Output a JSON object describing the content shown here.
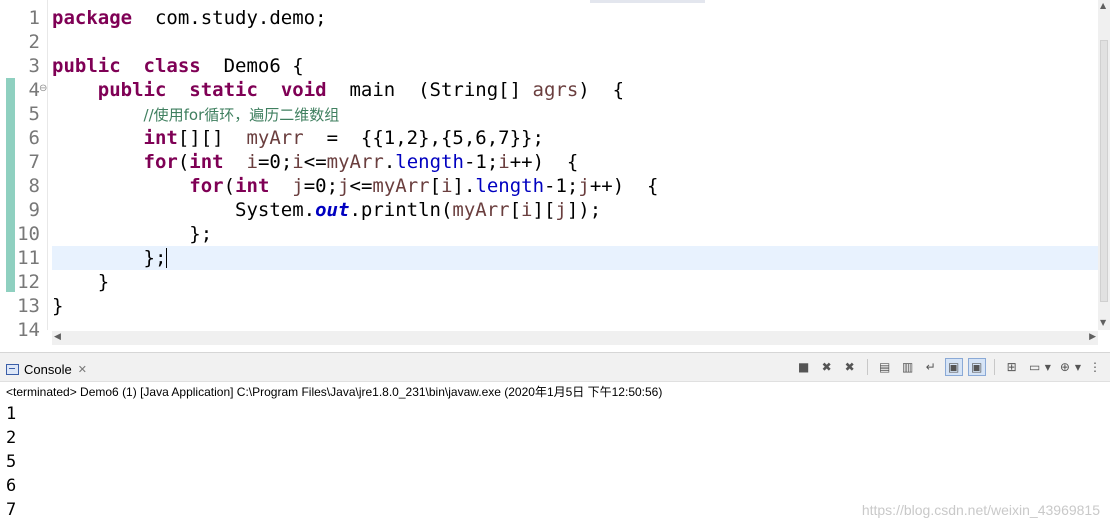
{
  "editor": {
    "lines": [
      {
        "num": "1",
        "segs": [
          [
            "kw",
            "package"
          ],
          [
            "",
            "  com.study.demo;"
          ]
        ]
      },
      {
        "num": "2",
        "segs": []
      },
      {
        "num": "3",
        "segs": [
          [
            "kw",
            "public"
          ],
          [
            "",
            "  "
          ],
          [
            "kw",
            "class"
          ],
          [
            "",
            "  Demo6 {"
          ]
        ]
      },
      {
        "num": "4",
        "fold": "⊖",
        "segs": [
          [
            "",
            "    "
          ],
          [
            "kw",
            "public"
          ],
          [
            "",
            "  "
          ],
          [
            "kw",
            "static"
          ],
          [
            "",
            "  "
          ],
          [
            "kw",
            "void"
          ],
          [
            "",
            "  main  (String[] "
          ],
          [
            "var",
            "agrs"
          ],
          [
            "",
            ")  {"
          ]
        ]
      },
      {
        "num": "5",
        "segs": [
          [
            "",
            "        "
          ],
          [
            "cm",
            "//使用for循环，遍历二维数组"
          ]
        ]
      },
      {
        "num": "6",
        "segs": [
          [
            "",
            "        "
          ],
          [
            "kw",
            "int"
          ],
          [
            "",
            "[][]  "
          ],
          [
            "var",
            "myArr"
          ],
          [
            "",
            "  =  {{1,2},{5,6,7}};"
          ]
        ]
      },
      {
        "num": "7",
        "segs": [
          [
            "",
            "        "
          ],
          [
            "kw",
            "for"
          ],
          [
            "",
            "("
          ],
          [
            "kw",
            "int"
          ],
          [
            "",
            "  "
          ],
          [
            "var",
            "i"
          ],
          [
            "",
            "=0;"
          ],
          [
            "var",
            "i"
          ],
          [
            "",
            "<="
          ],
          [
            "var",
            "myArr"
          ],
          [
            "",
            "."
          ],
          [
            "fld",
            "length"
          ],
          [
            "",
            "-1;"
          ],
          [
            "var",
            "i"
          ],
          [
            "",
            "++)  {"
          ]
        ]
      },
      {
        "num": "8",
        "segs": [
          [
            "",
            "            "
          ],
          [
            "kw",
            "for"
          ],
          [
            "",
            "("
          ],
          [
            "kw",
            "int"
          ],
          [
            "",
            "  "
          ],
          [
            "var",
            "j"
          ],
          [
            "",
            "=0;"
          ],
          [
            "var",
            "j"
          ],
          [
            "",
            "<="
          ],
          [
            "var",
            "myArr"
          ],
          [
            "",
            "["
          ],
          [
            "var",
            "i"
          ],
          [
            "",
            "]."
          ],
          [
            "fld",
            "length"
          ],
          [
            "",
            "-1;"
          ],
          [
            "var",
            "j"
          ],
          [
            "",
            "++)  {"
          ]
        ]
      },
      {
        "num": "9",
        "segs": [
          [
            "",
            "                System."
          ],
          [
            "sfld",
            "out"
          ],
          [
            "",
            ".println("
          ],
          [
            "var",
            "myArr"
          ],
          [
            "",
            "["
          ],
          [
            "var",
            "i"
          ],
          [
            "",
            "]["
          ],
          [
            "var",
            "j"
          ],
          [
            "",
            "]);"
          ]
        ]
      },
      {
        "num": "10",
        "segs": [
          [
            "",
            "            };"
          ]
        ]
      },
      {
        "num": "11",
        "current": true,
        "segs": [
          [
            "",
            "        };"
          ],
          [
            "caret",
            ""
          ]
        ]
      },
      {
        "num": "12",
        "segs": [
          [
            "",
            "    }"
          ]
        ]
      },
      {
        "num": "13",
        "segs": [
          [
            "",
            "}"
          ]
        ]
      },
      {
        "num": "14",
        "segs": []
      }
    ]
  },
  "console": {
    "tab_label": "Console",
    "tab_close": "✕",
    "status": "<terminated> Demo6 (1) [Java Application] C:\\Program Files\\Java\\jre1.8.0_231\\bin\\javaw.exe (2020年1月5日 下午12:50:56)",
    "output": [
      "1",
      "2",
      "5",
      "6",
      "7"
    ]
  },
  "watermark": "https://blog.csdn.net/weixin_43969815",
  "toolbar_icons": [
    "terminate-icon",
    "remove-launch-icon",
    "remove-all-launches-icon",
    "clear-console-icon",
    "scroll-lock-icon",
    "word-wrap-icon",
    "show-on-stdout-icon",
    "show-on-stderr-icon",
    "pin-console-icon",
    "display-selected-console-icon",
    "open-console-icon",
    "view-menu-icon"
  ],
  "colors": {
    "keyword": "#7f0055",
    "comment": "#3f7f5f",
    "field": "#0000c0",
    "variable": "#6a3e3e",
    "current_line": "#e8f2fe",
    "change_bar": "#8fd0c0"
  }
}
